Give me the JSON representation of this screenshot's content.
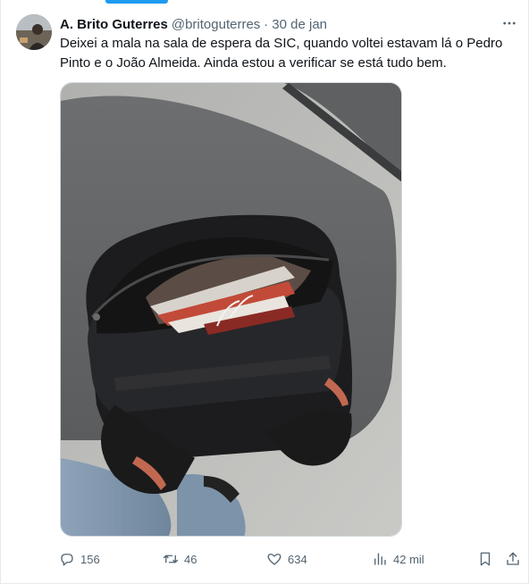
{
  "tweet": {
    "author": {
      "display_name": "A. Brito Guterres",
      "handle": "@britoguterres"
    },
    "separator": "·",
    "date": "30 de jan",
    "text": "Deixei a mala na sala de espera da SIC, quando voltei estavam lá o Pedro Pinto e o João Almeida. Ainda estou a verificar se está tudo bem.",
    "media": {
      "icon": "backpack-photo"
    }
  },
  "actions": {
    "replies": "156",
    "retweets": "46",
    "likes": "634",
    "views": "42 mil"
  },
  "colors": {
    "accent": "#1d9bf0",
    "text_primary": "#0f1419",
    "text_secondary": "#536471",
    "border": "#e7e9ea"
  }
}
